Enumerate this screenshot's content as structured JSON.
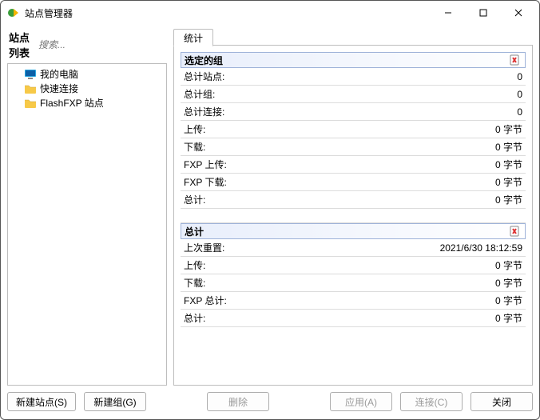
{
  "window": {
    "title": "站点管理器"
  },
  "sidebar": {
    "title": "站点列表",
    "search_placeholder": "搜索...",
    "items": [
      {
        "label": "我的电脑"
      },
      {
        "label": "快速连接"
      },
      {
        "label": "FlashFXP 站点"
      }
    ]
  },
  "tabs": [
    {
      "label": "统计"
    }
  ],
  "sections": {
    "selected_group": {
      "title": "选定的组",
      "rows": [
        {
          "key": "总计站点:",
          "value": "0"
        },
        {
          "key": "总计组:",
          "value": "0"
        },
        {
          "key": "总计连接:",
          "value": "0"
        },
        {
          "key": "上传:",
          "value": "0 字节"
        },
        {
          "key": "下载:",
          "value": "0 字节"
        },
        {
          "key": "FXP 上传:",
          "value": "0 字节"
        },
        {
          "key": "FXP 下载:",
          "value": "0 字节"
        },
        {
          "key": "总计:",
          "value": "0 字节"
        }
      ]
    },
    "total": {
      "title": "总计",
      "rows": [
        {
          "key": "上次重置:",
          "value": "2021/6/30 18:12:59"
        },
        {
          "key": "上传:",
          "value": "0 字节"
        },
        {
          "key": "下载:",
          "value": "0 字节"
        },
        {
          "key": "FXP 总计:",
          "value": "0 字节"
        },
        {
          "key": "总计:",
          "value": "0 字节"
        }
      ]
    }
  },
  "footer": {
    "new_site": "新建站点(S)",
    "new_group": "新建组(G)",
    "delete": "删除",
    "apply": "应用(A)",
    "connect": "连接(C)",
    "close": "关闭"
  }
}
